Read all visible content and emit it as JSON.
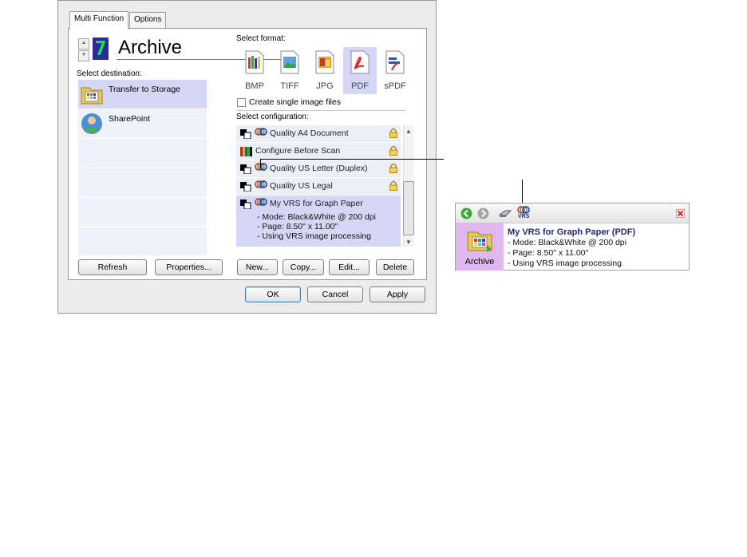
{
  "tabs": [
    "Multi Function",
    "Options"
  ],
  "destination": {
    "number": "7",
    "name": "Archive",
    "label": "Select destination:",
    "items": [
      {
        "label": "Transfer to Storage",
        "icon": "folder-icon",
        "selected": true
      },
      {
        "label": "SharePoint",
        "icon": "sharepoint-icon",
        "selected": false
      }
    ]
  },
  "format": {
    "label": "Select format:",
    "items": [
      "BMP",
      "TIFF",
      "JPG",
      "PDF",
      "sPDF"
    ],
    "selected": "PDF",
    "single_image_label": "Create single image files",
    "single_image_checked": false
  },
  "configuration": {
    "label": "Select configuration:",
    "items": [
      {
        "label": "Quality A4 Document",
        "locked": true
      },
      {
        "label": "Configure Before Scan",
        "locked": true
      },
      {
        "label": "Quality US Letter (Duplex)",
        "locked": true
      },
      {
        "label": "Quality US Legal",
        "locked": true
      }
    ],
    "selected": {
      "label": "My VRS for Graph Paper",
      "details": [
        "- Mode: Black&White @ 200 dpi",
        "- Page:  8.50\" x 11.00\"",
        "- Using VRS image processing"
      ]
    }
  },
  "buttons": {
    "refresh": "Refresh",
    "properties": "Properties...",
    "new": "New...",
    "copy": "Copy...",
    "edit": "Edit...",
    "delete": "Delete",
    "ok": "OK",
    "cancel": "Cancel",
    "apply": "Apply"
  },
  "popup": {
    "title": "My VRS for Graph Paper (PDF)",
    "details": [
      "- Mode: Black&White @ 200 dpi",
      "- Page:  8.50\" x 11.00\"",
      "- Using VRS image processing"
    ],
    "destination": "Archive",
    "vrs_badge": "VRS"
  },
  "colors": {
    "selection": "#d6d6f7",
    "row": "#f0f1fa",
    "digit_bg": "#2b2a9a",
    "digit_fg": "#18e43f",
    "popup_side": "#e0b8ef",
    "popup_title": "#1f2a7a"
  }
}
